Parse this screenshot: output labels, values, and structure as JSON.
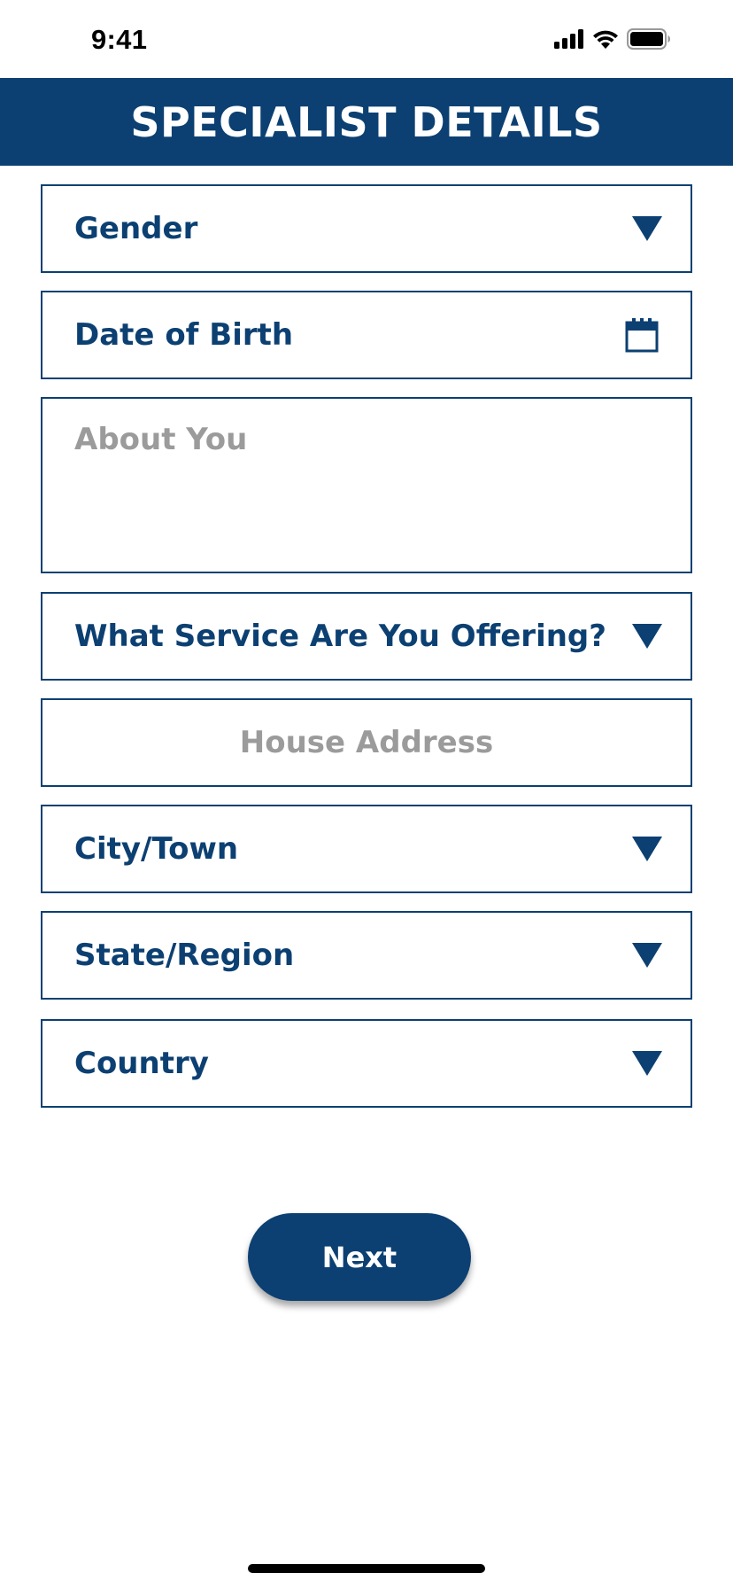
{
  "status_bar": {
    "time": "9:41",
    "icons": [
      "signal-icon",
      "wifi-icon",
      "battery-icon"
    ]
  },
  "header": {
    "title": "SPECIALIST DETAILS"
  },
  "form": {
    "gender": {
      "label": "Gender",
      "icon": "caret-down-icon"
    },
    "date_of_birth": {
      "label": "Date of Birth",
      "icon": "calendar-icon"
    },
    "about_you": {
      "placeholder": "About You"
    },
    "service": {
      "label": "What Service Are You Offering?",
      "icon": "caret-down-icon"
    },
    "house_address": {
      "placeholder": "House Address"
    },
    "city_town": {
      "label": "City/Town",
      "icon": "caret-down-icon"
    },
    "state_region": {
      "label": "State/Region",
      "icon": "caret-down-icon"
    },
    "country": {
      "label": "Country",
      "icon": "caret-down-icon"
    }
  },
  "actions": {
    "next_label": "Next"
  },
  "colors": {
    "primary": "#0c4072",
    "placeholder": "#9b9b9b",
    "background": "#ffffff"
  }
}
